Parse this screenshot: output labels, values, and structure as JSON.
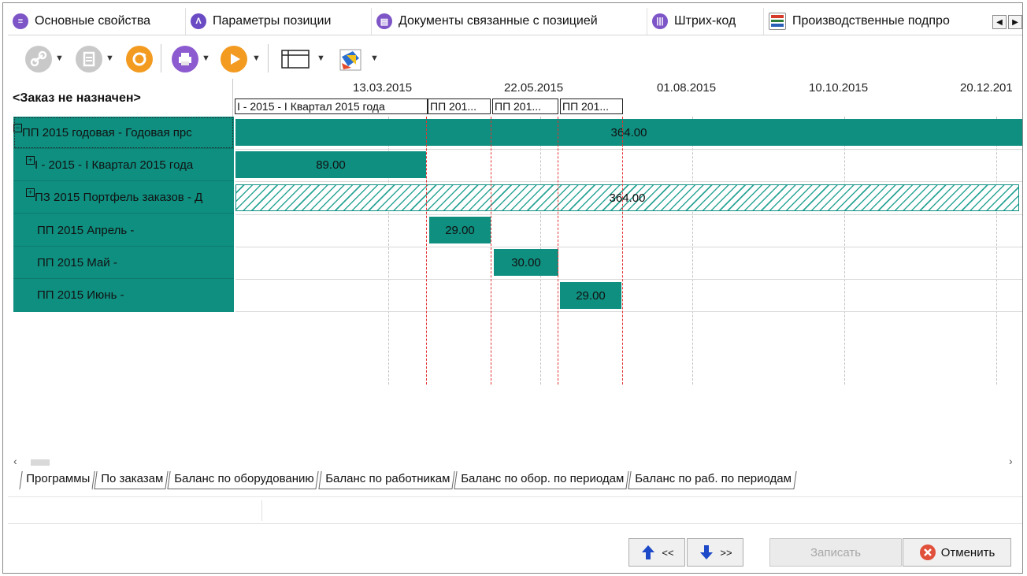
{
  "tabs": [
    {
      "label": "Основные свойства",
      "icon": "properties-icon",
      "color": "#7d55c7"
    },
    {
      "label": "Параметры позиции",
      "icon": "position-params-icon",
      "color": "#6a4bc4"
    },
    {
      "label": "Документы связанные с позицией",
      "icon": "documents-icon",
      "color": "#7d55c7"
    },
    {
      "label": "Штрих-код",
      "icon": "barcode-icon",
      "color": "#7d55c7"
    },
    {
      "label": "Производственные подпро",
      "icon": "production-icon",
      "color": "#d63a2a"
    }
  ],
  "gantt": {
    "order_header": "<Заказ не назначен>",
    "dates": [
      "13.03.2015",
      "22.05.2015",
      "01.08.2015",
      "10.10.2015",
      "20.12.201"
    ],
    "periods": [
      "I - 2015 - I Квартал 2015 года",
      "ПП 201...",
      "ПП 201...",
      "ПП 201..."
    ],
    "rows": [
      {
        "label": "ПП 2015 годовая - Годовая прс",
        "toggle": "⊟",
        "value": "364.00"
      },
      {
        "label": "I - 2015 - I Квартал 2015 года",
        "toggle": "⊞",
        "value": "89.00"
      },
      {
        "label": "ПЗ 2015 Портфель заказов - Д",
        "toggle": "⊞",
        "value": "364.00"
      },
      {
        "label": "ПП 2015 Апрель -",
        "toggle": "",
        "value": "29.00"
      },
      {
        "label": "ПП 2015 Май -",
        "toggle": "",
        "value": "30.00"
      },
      {
        "label": "ПП 2015 Июнь -",
        "toggle": "",
        "value": "29.00"
      }
    ]
  },
  "bottom_tabs": [
    "Программы",
    "По заказам",
    "Баланс по оборудованию",
    "Баланс по работникам",
    "Баланс по обор. по периодам",
    "Баланс по раб. по периодам"
  ],
  "buttons": {
    "prev": "<<",
    "next": ">>",
    "save": "Записать",
    "cancel": "Отменить"
  },
  "colors": {
    "accent_teal": "#0f8f80",
    "red_marker": "#e53030"
  }
}
